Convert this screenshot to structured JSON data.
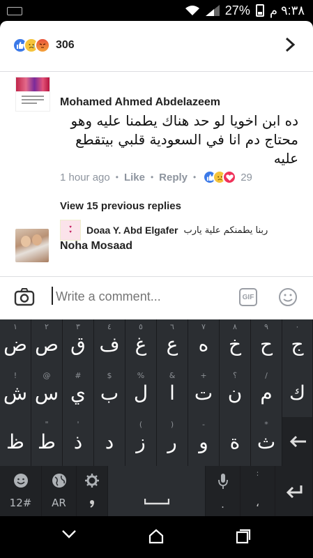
{
  "status": {
    "time": "٩:٣٨ م",
    "battery": "27%"
  },
  "post_header": {
    "reaction_count": "306",
    "reactions": [
      "like",
      "sad",
      "angry"
    ]
  },
  "comments": [
    {
      "author": "Mohamed Ahmed Abdelazeem",
      "text": "ده ابن اخويا لو حد هناك يطمنا عليه وهو محتاج دم انا في السعودية قلبي بيتقطع عليه",
      "time": "1 hour ago",
      "like_label": "Like",
      "reply_label": "Reply",
      "reaction_count": "29",
      "reactions": [
        "like",
        "sad",
        "love"
      ]
    }
  ],
  "replies": {
    "view_previous": "View 15 previous replies",
    "latest": {
      "author": "Doaa Y. Abd Elgafer",
      "text": "ربنا يطمنكم علية يارب"
    }
  },
  "comment2": {
    "author": "Noha Mosaad"
  },
  "composer": {
    "placeholder": "Write a comment...",
    "gif_label": "GIF"
  },
  "keyboard": {
    "row1": [
      {
        "key": "ض",
        "sec": "١"
      },
      {
        "key": "ص",
        "sec": "٢"
      },
      {
        "key": "ق",
        "sec": "٣"
      },
      {
        "key": "ف",
        "sec": "٤"
      },
      {
        "key": "غ",
        "sec": "٥"
      },
      {
        "key": "ع",
        "sec": "٦"
      },
      {
        "key": "ه",
        "sec": "٧"
      },
      {
        "key": "خ",
        "sec": "٨"
      },
      {
        "key": "ح",
        "sec": "٩"
      },
      {
        "key": "ج",
        "sec": "٠"
      }
    ],
    "row2": [
      {
        "key": "ش",
        "sec": "!"
      },
      {
        "key": "س",
        "sec": "@"
      },
      {
        "key": "ي",
        "sec": "#"
      },
      {
        "key": "ب",
        "sec": "$"
      },
      {
        "key": "ل",
        "sec": "%"
      },
      {
        "key": "ا",
        "sec": "&"
      },
      {
        "key": "ت",
        "sec": "+"
      },
      {
        "key": "ن",
        "sec": "؟"
      },
      {
        "key": "م",
        "sec": "/"
      },
      {
        "key": "ك",
        "sec": ""
      }
    ],
    "row3": [
      {
        "key": "ظ",
        "sec": ""
      },
      {
        "key": "ط",
        "sec": "\""
      },
      {
        "key": "ذ",
        "sec": "'"
      },
      {
        "key": "د",
        "sec": ""
      },
      {
        "key": "ز",
        "sec": "("
      },
      {
        "key": "ر",
        "sec": ")"
      },
      {
        "key": "و",
        "sec": "-"
      },
      {
        "key": "ة",
        "sec": ""
      },
      {
        "key": "ث",
        "sec": "*"
      }
    ],
    "row4": {
      "numbers_label": "12#",
      "language_label": "AR"
    }
  }
}
